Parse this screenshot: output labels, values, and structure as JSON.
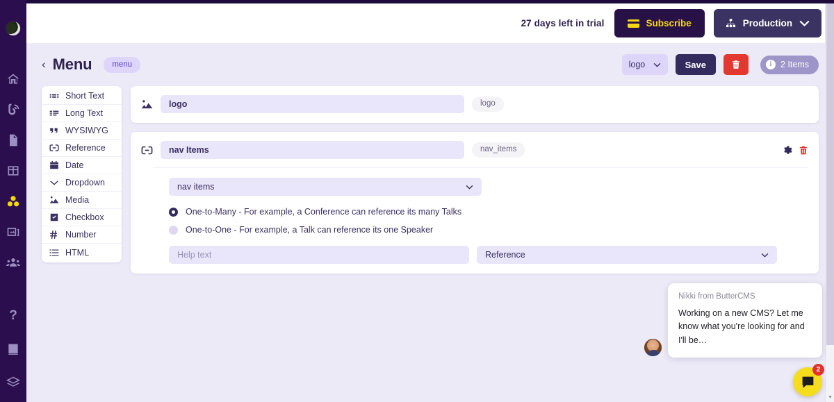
{
  "sidebar": {
    "avatar_name": "user-avatar",
    "items": [
      {
        "name": "home-icon",
        "icon": "home",
        "active": false
      },
      {
        "name": "blog-icon",
        "icon": "blog",
        "active": false
      },
      {
        "name": "pages-icon",
        "icon": "page",
        "active": false
      },
      {
        "name": "page-types-icon",
        "icon": "grid",
        "active": false
      },
      {
        "name": "collections-icon",
        "icon": "collections",
        "active": true
      },
      {
        "name": "media-icon",
        "icon": "media",
        "active": false
      },
      {
        "name": "team-icon",
        "icon": "team",
        "active": false
      }
    ],
    "bottom_items": [
      {
        "name": "help-icon",
        "icon": "question",
        "label": "?"
      },
      {
        "name": "docs-icon",
        "icon": "book",
        "label": ""
      },
      {
        "name": "stack-icon",
        "icon": "stack",
        "label": ""
      }
    ]
  },
  "topbar": {
    "trial_text": "27 days left in trial",
    "subscribe_label": "Subscribe",
    "subscribe_icon": "credit-card-icon",
    "environment_label": "Production",
    "environment_icon": "sitemap-icon",
    "chevron_icon": "chevron-down-icon"
  },
  "page_header": {
    "back_icon": "chevron-left-icon",
    "title": "Menu",
    "slug": "menu",
    "select_value": "logo",
    "save_label": "Save",
    "delete_icon": "trash-icon",
    "items_count_label": "2 Items",
    "info_icon": "info-icon"
  },
  "field_types": [
    {
      "label": "Short Text",
      "icon": "short-text-icon"
    },
    {
      "label": "Long Text",
      "icon": "long-text-icon"
    },
    {
      "label": "WYSIWYG",
      "icon": "quote-icon"
    },
    {
      "label": "Reference",
      "icon": "reference-icon"
    },
    {
      "label": "Date",
      "icon": "calendar-icon"
    },
    {
      "label": "Dropdown",
      "icon": "chevron-down-icon"
    },
    {
      "label": "Media",
      "icon": "image-icon"
    },
    {
      "label": "Checkbox",
      "icon": "checkbox-icon"
    },
    {
      "label": "Number",
      "icon": "hash-icon"
    },
    {
      "label": "HTML",
      "icon": "list-icon"
    }
  ],
  "fields": [
    {
      "type_icon": "image-icon",
      "name_value": "logo",
      "key": "logo"
    },
    {
      "type_icon": "reference-icon",
      "name_value": "nav Items",
      "key": "nav_items",
      "gear_icon": "gear-icon",
      "delete_icon": "trash-icon",
      "collection_select": "nav items",
      "options": [
        {
          "label": "One-to-Many - For example, a Conference can reference its many Talks",
          "selected": true
        },
        {
          "label": "One-to-One - For example, a Talk can reference its one Speaker",
          "selected": false
        }
      ],
      "help_placeholder": "Help text",
      "help_value": "",
      "type_select": "Reference"
    }
  ],
  "chat": {
    "from": "Nikki from ButterCMS",
    "message": "Working on a new CMS? Let me know what you're looking for and I'll be…",
    "badge": "2",
    "launcher_icon": "chat-bubble-icon",
    "avatar_name": "agent-avatar"
  },
  "colors": {
    "sidebar": "#2b0e4d",
    "accent_yellow": "#f5d90a",
    "background": "#eceaf7",
    "danger": "#e3382f",
    "primary_dark": "#332a5e",
    "input_bg": "#e9e5fa"
  }
}
